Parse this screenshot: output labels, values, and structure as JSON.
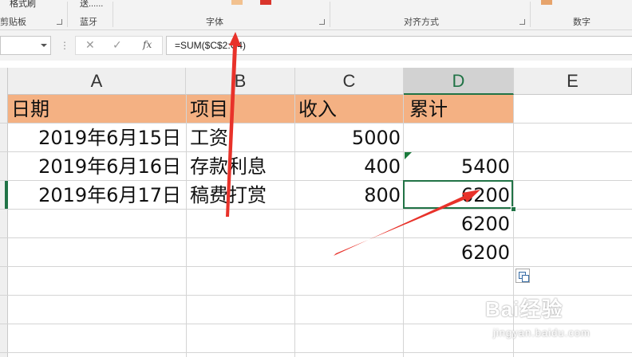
{
  "ribbon": {
    "format_painter_label": "格式刷",
    "bluetooth_button_label": "送......",
    "groups": {
      "clipboard": "剪贴板",
      "bluetooth": "蓝牙",
      "font": "字体",
      "alignment": "对齐方式",
      "number": "数字"
    }
  },
  "formula_bar": {
    "name_box_value": "",
    "formula": "=SUM($C$2:C4)"
  },
  "sheet": {
    "columns": [
      "A",
      "B",
      "C",
      "D",
      "E"
    ],
    "selected_column": "D",
    "selected_cell": "D4",
    "headers": [
      "日期",
      "项目",
      "收入",
      "累计"
    ],
    "header_fill": "#F4B183",
    "rows": [
      {
        "date": "2019年6月15日",
        "item": "工资",
        "income": "5000",
        "cumulative": ""
      },
      {
        "date": "2019年6月16日",
        "item": "存款利息",
        "income": "400",
        "cumulative": "5400"
      },
      {
        "date": "2019年6月17日",
        "item": "稿费打赏",
        "income": "800",
        "cumulative": "6200"
      },
      {
        "date": "",
        "item": "",
        "income": "",
        "cumulative": "6200"
      },
      {
        "date": "",
        "item": "",
        "income": "",
        "cumulative": "6200"
      }
    ]
  },
  "annotation": {
    "arrow_color": "#E8322A"
  },
  "watermark": {
    "brand": "Bai经验",
    "url": "jingyan.baidu.com"
  }
}
